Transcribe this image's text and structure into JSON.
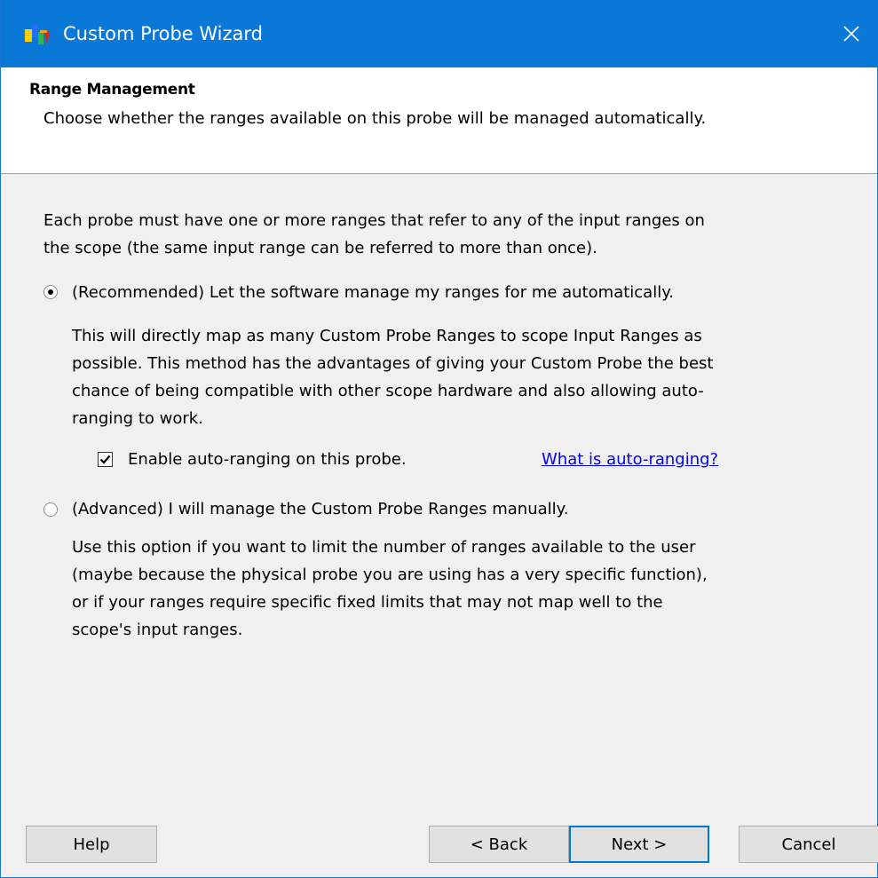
{
  "window": {
    "title": "Custom Probe Wizard"
  },
  "header": {
    "title": "Range Management",
    "description": "Choose whether the ranges available on this probe will be managed automatically."
  },
  "content": {
    "intro_line1": "Each probe must have one or more ranges that refer to any of the input ranges on",
    "intro_line2": "the scope (the same input range can be referred to more than once).",
    "option_recommended": {
      "label": "(Recommended) Let the software manage my ranges for me automatically.",
      "selected": true,
      "desc_lines": [
        "This will directly map as many Custom Probe Ranges to scope Input Ranges as",
        "possible. This method has the advantages of giving your Custom Probe the best",
        "chance of being compatible with other scope hardware and also allowing auto-",
        "ranging to work."
      ]
    },
    "auto_ranging": {
      "label": "Enable auto-ranging on this probe.",
      "checked": true,
      "help_link": "What is auto-ranging?"
    },
    "option_advanced": {
      "label": "(Advanced) I will manage the Custom Probe Ranges manually.",
      "selected": false,
      "desc_lines": [
        "Use this option if you want to limit the number of ranges available to the user",
        "(maybe because the physical probe you are using has a very specific function),",
        "or if your ranges require specific fixed limits that may not map well to the",
        "scope's input ranges."
      ]
    }
  },
  "footer": {
    "help_label": "Help",
    "back_label": "< Back",
    "next_label": "Next >",
    "cancel_label": "Cancel"
  },
  "icons": {
    "app": "probe-wizard-app-icon",
    "close": "close-icon"
  },
  "colors": {
    "titlebar": "#0a78d7",
    "link": "#0000ff",
    "default_button_border": "#0078d7"
  }
}
